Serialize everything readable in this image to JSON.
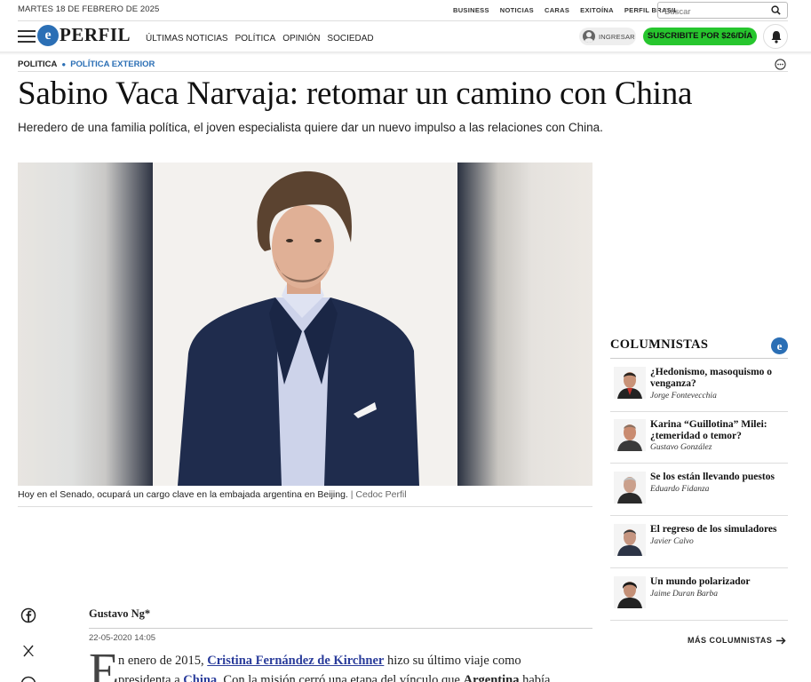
{
  "header": {
    "date": "MARTES 18 DE FEBRERO DE 2025",
    "top_links": [
      "BUSINESS",
      "NOTICIAS",
      "CARAS",
      "EXITOÍNA",
      "PERFIL BRASIL"
    ],
    "search_placeholder": "Buscar",
    "logo_text": "PERFIL",
    "logo_mark": "e",
    "menu": [
      "ÚLTIMAS NOTICIAS",
      "POLÍTICA",
      "OPINIÓN",
      "SOCIEDAD"
    ],
    "login_label": "INGRESAR",
    "subscribe_label": "SUSCRIBITE POR $26/DÍA",
    "brand_color": "#2b6fb5",
    "subscribe_color": "#27c62e"
  },
  "article": {
    "section": "POLITICA",
    "subsection": "POLÍTICA EXTERIOR",
    "title": "Sabino Vaca Narvaja: retomar un camino con China",
    "subtitle": "Heredero de una familia política, el joven especialista quiere dar un nuevo impulso a las relaciones con China.",
    "caption": "Hoy en el Senado, ocupará un cargo clave en la embajada argentina en Beijing.",
    "caption_credit": " | Cedoc Perfil",
    "author": "Gustavo Ng*",
    "date": "22-05-2020 14:05",
    "dropcap": "E",
    "line1_a": "n enero de 2015, ",
    "line1_link": "Cristina Fernández de Kirchner",
    "line1_b": " hizo su último viaje como",
    "line2_a": "presidenta a ",
    "line2_link": "China",
    "line2_b": ". Con la misión cerró una etapa del vínculo que ",
    "line2_bold": "Argentina",
    "line2_c": " había"
  },
  "columnists": {
    "heading": "COLUMNISTAS",
    "items": [
      {
        "title": "¿Hedonismo, masoquismo o venganza?",
        "author": "Jorge Fontevecchia"
      },
      {
        "title": "Karina “Guillotina” Milei: ¿temeridad o temor?",
        "author": "Gustavo González"
      },
      {
        "title": "Se los están llevando puestos",
        "author": "Eduardo Fidanza"
      },
      {
        "title": "El regreso de los simuladores",
        "author": "Javier Calvo"
      },
      {
        "title": "Un mundo polarizador",
        "author": "Jaime Duran Barba"
      }
    ],
    "more_label": "MÁS COLUMNISTAS"
  },
  "share_icons": [
    "facebook-icon",
    "x-icon",
    "whatsapp-icon"
  ]
}
